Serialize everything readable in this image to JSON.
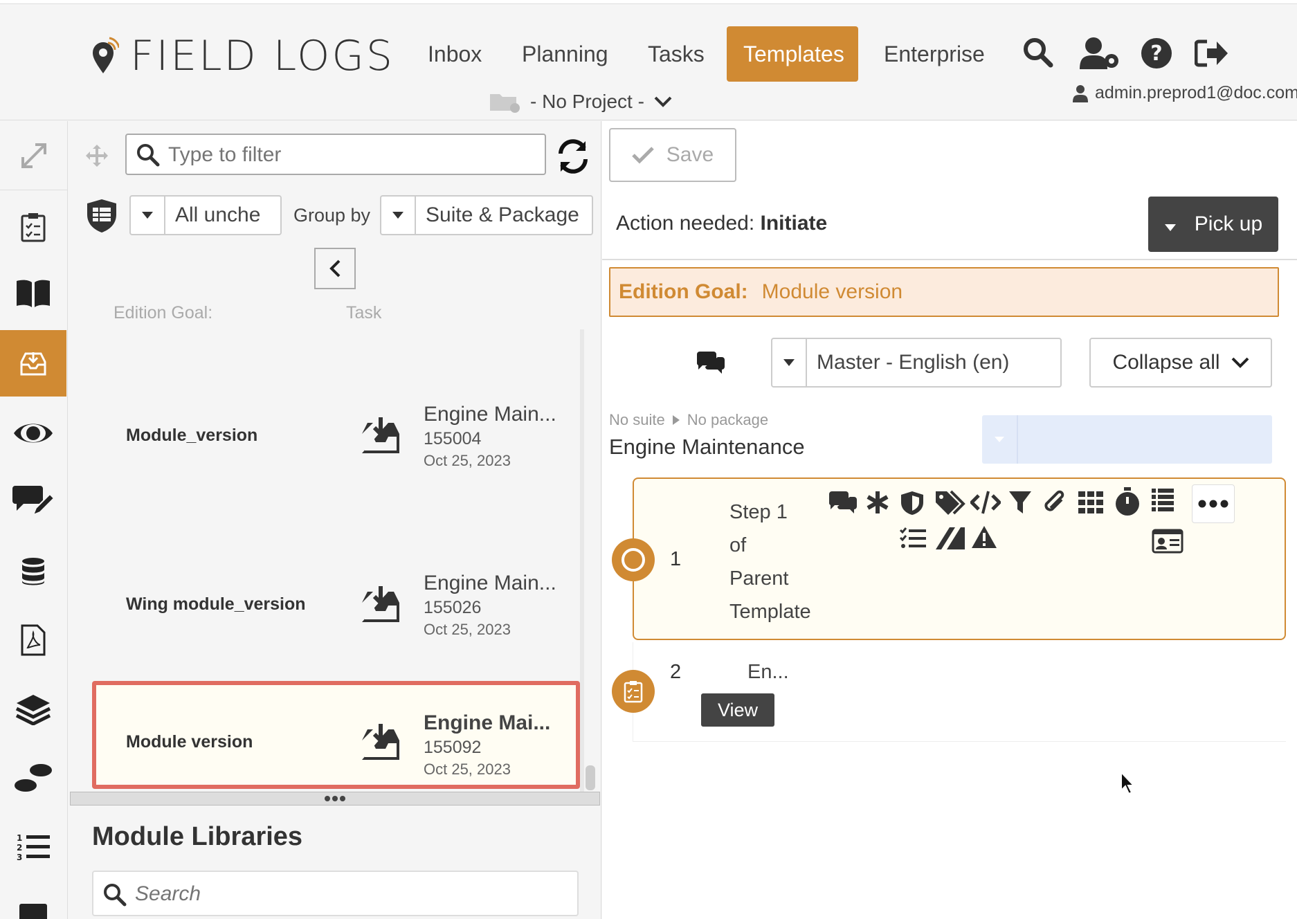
{
  "header": {
    "logo_text": "FIELD LOGS",
    "nav": [
      {
        "label": "Inbox",
        "active": false
      },
      {
        "label": "Planning",
        "active": false
      },
      {
        "label": "Tasks",
        "active": false
      },
      {
        "label": "Templates",
        "active": true
      },
      {
        "label": "Enterprise",
        "active": false
      }
    ],
    "icons": [
      "search-icon",
      "user-settings-icon",
      "help-icon",
      "logout-icon"
    ],
    "project_selector": "- No Project -",
    "user_email": "admin.preprod1@doc.com"
  },
  "rail": {
    "icons": [
      "expand-icon",
      "checklist-icon",
      "book-icon",
      "inbox-icon",
      "eye-icon",
      "comment-edit-icon",
      "database-icon",
      "pdf-icon",
      "layers-icon",
      "footsteps-icon",
      "numbered-list-icon",
      "more-icon"
    ],
    "active_icon": "inbox-icon"
  },
  "filter": {
    "placeholder": "Type to filter",
    "status_filter": "All unche",
    "group_by_label": "Group by",
    "group_by_value": "Suite & Package"
  },
  "list": {
    "columns": [
      "Edition Goal:",
      "Task"
    ],
    "items": [
      {
        "goal": "Module_version",
        "task_name": "Engine Main...",
        "task_id": "155004",
        "date": "Oct 25, 2023",
        "selected": false
      },
      {
        "goal": "Wing module_version",
        "task_name": "Engine Main...",
        "task_id": "155026",
        "date": "Oct 25, 2023",
        "selected": false
      },
      {
        "goal": "Module version",
        "task_name": "Engine Mai...",
        "task_id": "155092",
        "date": "Oct 25, 2023",
        "selected": true
      }
    ]
  },
  "module_libraries": {
    "title": "Module Libraries",
    "search_placeholder": "Search"
  },
  "detail": {
    "save_label": "Save",
    "action_prefix": "Action needed:",
    "action_value": "Initiate",
    "pickup_label": "Pick up",
    "edition_goal_label": "Edition Goal:",
    "edition_goal_value": "Module version",
    "language": "Master - English (en)",
    "collapse_label": "Collapse all",
    "breadcrumb_suite": "No suite",
    "breadcrumb_package": "No package",
    "document_title": "Engine Maintenance",
    "steps": [
      {
        "number": "1",
        "label_lines": [
          "Step 1",
          "of",
          "Parent",
          "Template"
        ]
      },
      {
        "number": "2",
        "label": "En...",
        "view_label": "View"
      }
    ]
  },
  "colors": {
    "accent": "#d08a33",
    "selected_border": "#e06c60",
    "dark_button": "#444444",
    "edition_goal_bg": "#fcebdd"
  }
}
